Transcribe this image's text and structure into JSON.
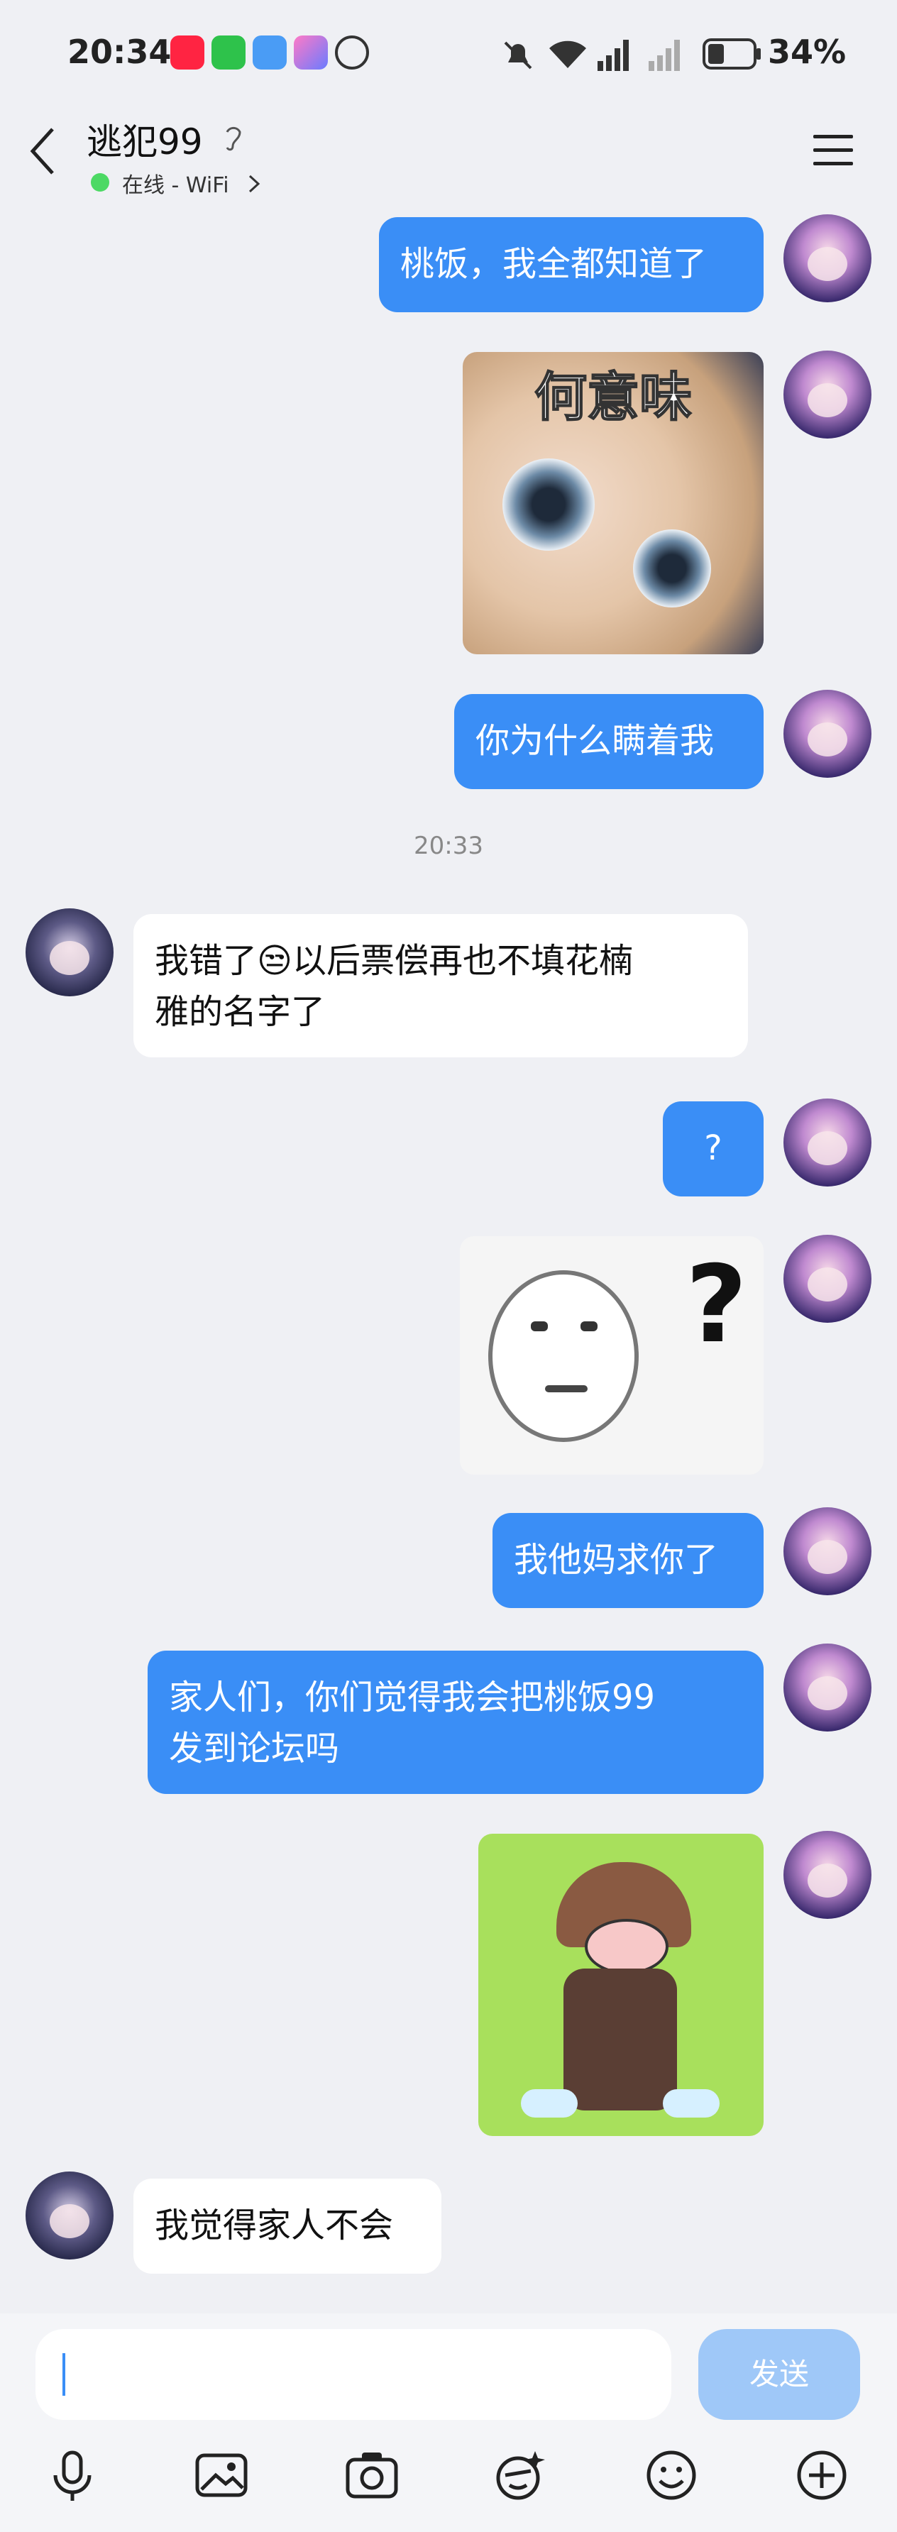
{
  "status_bar": {
    "time": "20:34",
    "battery": "34%",
    "icons": [
      "xiaohongshu-icon",
      "wechat-icon",
      "weather-icon",
      "app-icon",
      "hand-icon",
      "mute-icon",
      "wifi-icon",
      "5g-signal-icon",
      "signal-icon",
      "battery-icon"
    ]
  },
  "header": {
    "title": "逃犯99",
    "status": "在线 - WiFi"
  },
  "messages": [
    {
      "from": "me",
      "text": "桃饭，我全都知道了"
    },
    {
      "from": "me",
      "sticker": "何意味"
    },
    {
      "from": "me",
      "text": "你为什么瞒着我"
    },
    {
      "from": "them",
      "text": "我错了😒以后票偿再也不填花楠雅的名字了"
    },
    {
      "from": "me",
      "text": "?"
    },
    {
      "from": "me",
      "sticker_mark": "?"
    },
    {
      "from": "me",
      "text": "我他妈求你了"
    },
    {
      "from": "me",
      "text": "家人们，你们觉得我会把桃饭99发到论坛吗"
    },
    {
      "from": "me",
      "sticker": "crying-girl"
    },
    {
      "from": "them",
      "text": "我觉得家人不会"
    }
  ],
  "timestamp": "20:33",
  "them_line1": "我错了😒以后票偿再也不填花楠",
  "them_line2": "雅的名字了",
  "me_long_line1": "家人们，你们觉得我会把桃饭99",
  "me_long_line2": "发到论坛吗",
  "input": {
    "value": "",
    "send_label": "发送"
  },
  "toolbar": [
    "mic-icon",
    "image-icon",
    "camera-icon",
    "sticker-icon",
    "emoji-icon",
    "plus-icon"
  ]
}
